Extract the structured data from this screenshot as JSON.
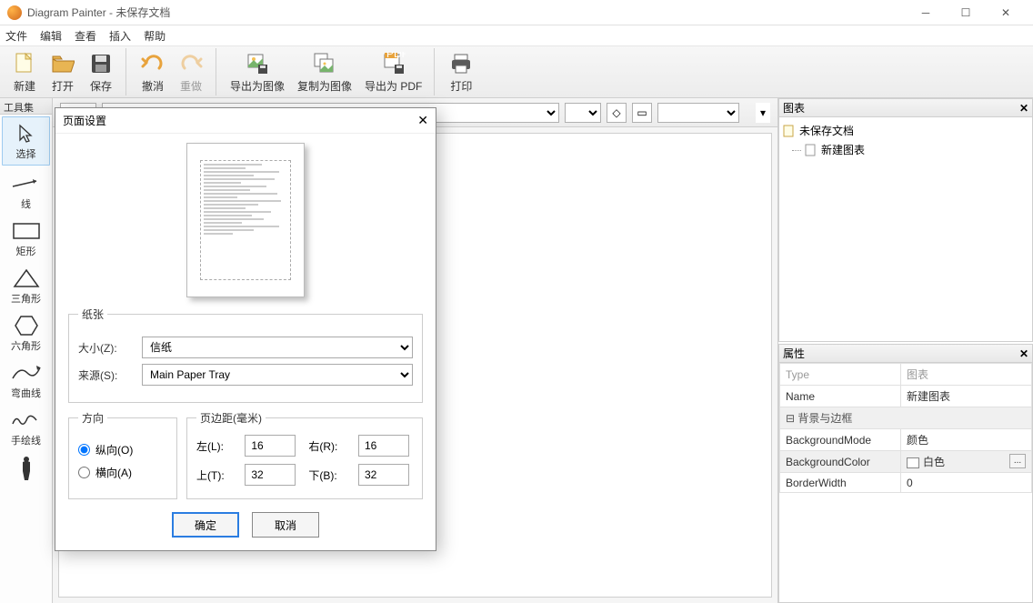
{
  "app": {
    "title": "Diagram Painter - 未保存文档"
  },
  "menu": {
    "file": "文件",
    "edit": "编辑",
    "view": "查看",
    "insert": "插入",
    "help": "帮助"
  },
  "toolbar": {
    "new": "新建",
    "open": "打开",
    "save": "保存",
    "undo": "撤消",
    "redo": "重做",
    "export_image": "导出为图像",
    "copy_image": "复制为图像",
    "export_pdf": "导出为 PDF",
    "print": "打印"
  },
  "palette": {
    "title": "工具集",
    "select": "选择",
    "line": "线",
    "rect": "矩形",
    "triangle": "三角形",
    "hexagon": "六角形",
    "curve": "弯曲线",
    "freehand": "手绘线"
  },
  "right": {
    "diagrams_title": "图表",
    "tree_root": "未保存文档",
    "tree_child": "新建图表",
    "props_title": "属性",
    "prop_type_key": "Type",
    "prop_type_val": "图表",
    "prop_name_key": "Name",
    "prop_name_val": "新建图表",
    "prop_section": "背景与边框",
    "prop_bgmode_key": "BackgroundMode",
    "prop_bgmode_val": "颜色",
    "prop_bgcolor_key": "BackgroundColor",
    "prop_bgcolor_val": "白色",
    "prop_border_key": "BorderWidth",
    "prop_border_val": "0",
    "ellipsis": "..."
  },
  "dialog": {
    "title": "页面设置",
    "paper_legend": "纸张",
    "size_label": "大小(Z):",
    "size_value": "信纸",
    "source_label": "来源(S):",
    "source_value": "Main Paper Tray",
    "orient_legend": "方向",
    "portrait": "纵向(O)",
    "landscape": "横向(A)",
    "margins_legend": "页边距(毫米)",
    "left_label": "左(L):",
    "left_val": "16",
    "right_label": "右(R):",
    "right_val": "16",
    "top_label": "上(T):",
    "top_val": "32",
    "bottom_label": "下(B):",
    "bottom_val": "32",
    "ok": "确定",
    "cancel": "取消"
  }
}
